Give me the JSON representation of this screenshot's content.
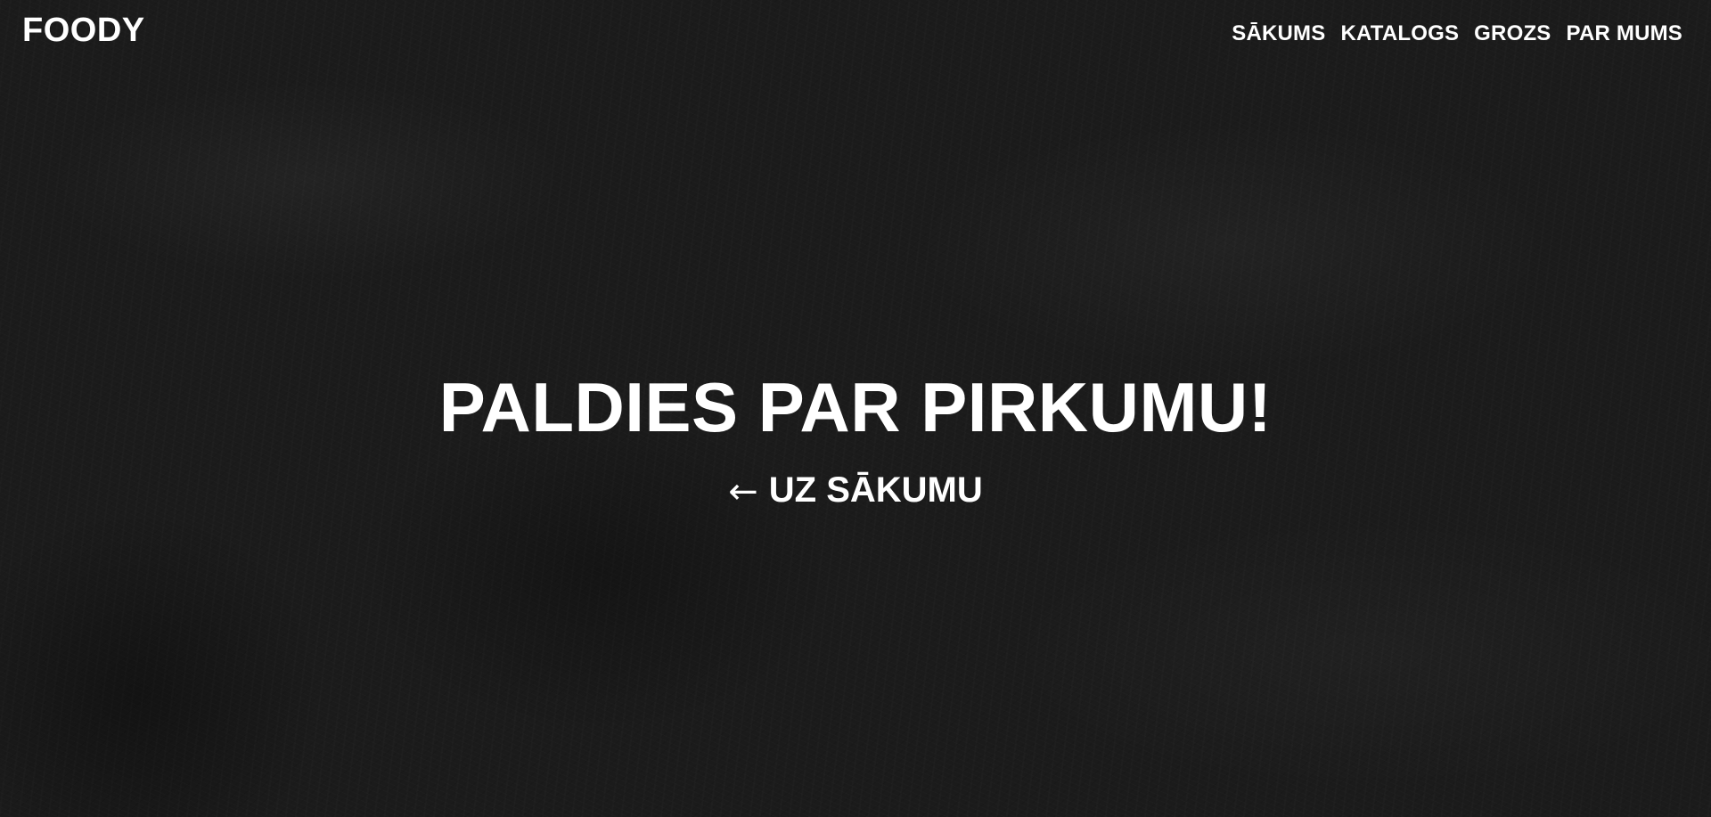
{
  "header": {
    "logo": "FOODY",
    "nav": [
      {
        "label": "SĀKUMS"
      },
      {
        "label": "KATALOGS"
      },
      {
        "label": "GROZS"
      },
      {
        "label": "PAR MUMS"
      }
    ]
  },
  "hero": {
    "title": "PALDIES PAR PIRKUMU!",
    "back_link": {
      "arrow": "←",
      "label": "UZ SĀKUMU"
    }
  },
  "colors": {
    "background": "#1b1b1b",
    "text": "#ffffff"
  }
}
